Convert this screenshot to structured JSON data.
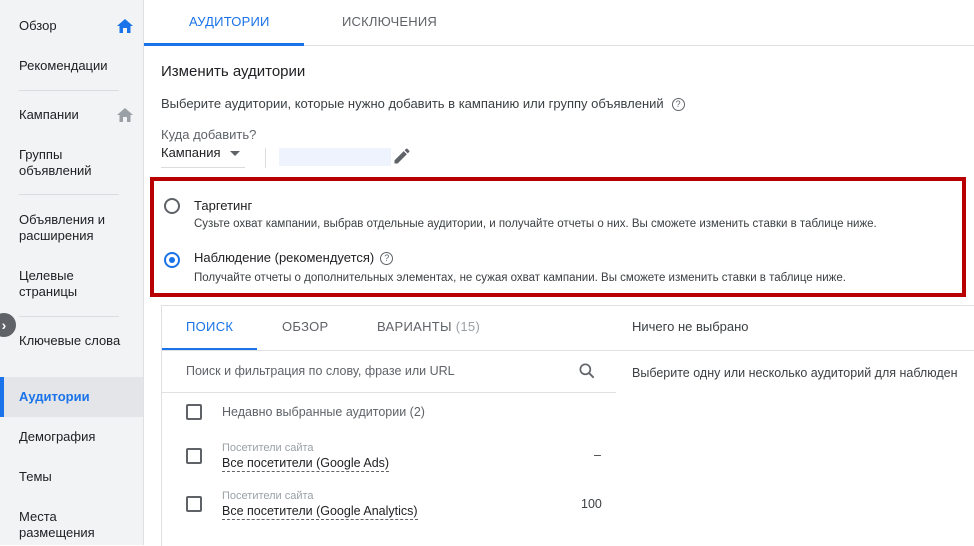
{
  "sidebar": {
    "items": [
      {
        "label": "Обзор"
      },
      {
        "label": "Рекомендации"
      },
      {
        "label": "Кампании"
      },
      {
        "label": "Группы объявлений"
      },
      {
        "label": "Объявления и расширения"
      },
      {
        "label": "Целевые страницы"
      },
      {
        "label": "Ключевые слова"
      },
      {
        "label": "Аудитории"
      },
      {
        "label": "Демография"
      },
      {
        "label": "Темы"
      },
      {
        "label": "Места размещения"
      }
    ],
    "active": "Аудитории",
    "collapse_icon": "chevron-right-icon"
  },
  "tabs": [
    {
      "label": "АУДИТОРИИ",
      "active": true
    },
    {
      "label": "ИСКЛЮЧЕНИЯ",
      "active": false
    }
  ],
  "section": {
    "title": "Изменить аудитории",
    "description": "Выберите аудитории, которые нужно добавить в кампанию или группу объявлений",
    "where_label": "Куда добавить?",
    "where_value": "Кампания"
  },
  "modes": [
    {
      "title": "Таргетинг",
      "description": "Сузьте охват кампании, выбрав отдельные аудитории, и получайте отчеты о них. Вы сможете изменить ставки в таблице ниже.",
      "checked": false
    },
    {
      "title": "Наблюдение (рекомендуется)",
      "description": "Получайте отчеты о дополнительных элементах, не сужая охват кампании. Вы сможете изменить ставки в таблице ниже.",
      "checked": true
    }
  ],
  "browse": {
    "tabs": [
      {
        "label": "ПОИСК",
        "count": ""
      },
      {
        "label": "ОБЗОР",
        "count": ""
      },
      {
        "label": "ВАРИАНТЫ",
        "count": "(15)"
      }
    ],
    "search_placeholder": "Поиск и фильтрация по слову, фразе или URL",
    "recent": "Недавно выбранные аудитории (2)",
    "rows": [
      {
        "category": "Посетители сайта",
        "name": "Все посетители (Google Ads)",
        "value": "–"
      },
      {
        "category": "Посетители сайта",
        "name": "Все посетители (Google Analytics)",
        "value": "100"
      }
    ]
  },
  "selected": {
    "header": "Ничего не выбрано",
    "hint": "Выберите одну или несколько аудиторий для наблюден"
  },
  "colors": {
    "accent": "#1a73e8",
    "highlight_border": "#b80000"
  }
}
